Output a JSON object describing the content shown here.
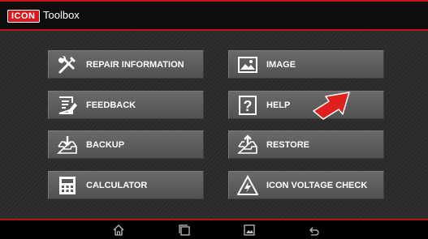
{
  "app": {
    "logo_text": "ICON",
    "title": "Toolbox"
  },
  "colors": {
    "accent": "#c4151b",
    "tile": "#5e5e5e",
    "arrow": "#e0201f"
  },
  "tiles": [
    {
      "label": "REPAIR INFORMATION",
      "icon": "wrench-screwdriver-icon"
    },
    {
      "label": "IMAGE",
      "icon": "image-icon"
    },
    {
      "label": "FEEDBACK",
      "icon": "feedback-form-icon"
    },
    {
      "label": "HELP",
      "icon": "question-mark-icon"
    },
    {
      "label": "BACKUP",
      "icon": "backup-tray-icon"
    },
    {
      "label": "RESTORE",
      "icon": "restore-tray-icon"
    },
    {
      "label": "CALCULATOR",
      "icon": "calculator-icon"
    },
    {
      "label": "ICON VOLTAGE CHECK",
      "icon": "high-voltage-warning-icon"
    }
  ],
  "navbar": [
    "home-icon",
    "recent-apps-icon",
    "screenshot-icon",
    "back-icon"
  ]
}
